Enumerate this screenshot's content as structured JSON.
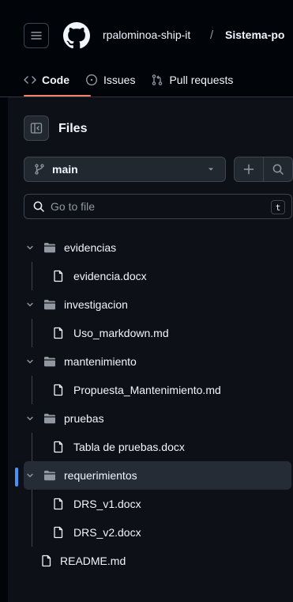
{
  "header": {
    "owner": "rpalominoa-ship-it",
    "separator": "/",
    "repo": "Sistema-po"
  },
  "tabs": [
    {
      "label": "Code",
      "icon": "code-icon",
      "active": true
    },
    {
      "label": "Issues",
      "icon": "issue-opened-icon",
      "active": false
    },
    {
      "label": "Pull requests",
      "icon": "git-pull-request-icon",
      "active": false
    }
  ],
  "panel": {
    "title": "Files",
    "branch": "main",
    "search_placeholder": "Go to file",
    "search_shortcut": "t"
  },
  "tree": {
    "folders": [
      {
        "name": "evidencias",
        "files": [
          "evidencia.docx"
        ]
      },
      {
        "name": "investigacion",
        "files": [
          "Uso_markdown.md"
        ]
      },
      {
        "name": "mantenimiento",
        "files": [
          "Propuesta_Mantenimiento.md"
        ]
      },
      {
        "name": "pruebas",
        "files": [
          "Tabla de pruebas.docx"
        ]
      },
      {
        "name": "requerimientos",
        "files": [
          "DRS_v1.docx",
          "DRS_v2.docx"
        ],
        "selected": true
      }
    ],
    "root_files": [
      "README.md"
    ]
  },
  "colors": {
    "background": "#010409",
    "panel": "#0d1117",
    "accent_underline": "#f78166",
    "selection_marker": "#4493f8",
    "border": "#3d444d"
  }
}
